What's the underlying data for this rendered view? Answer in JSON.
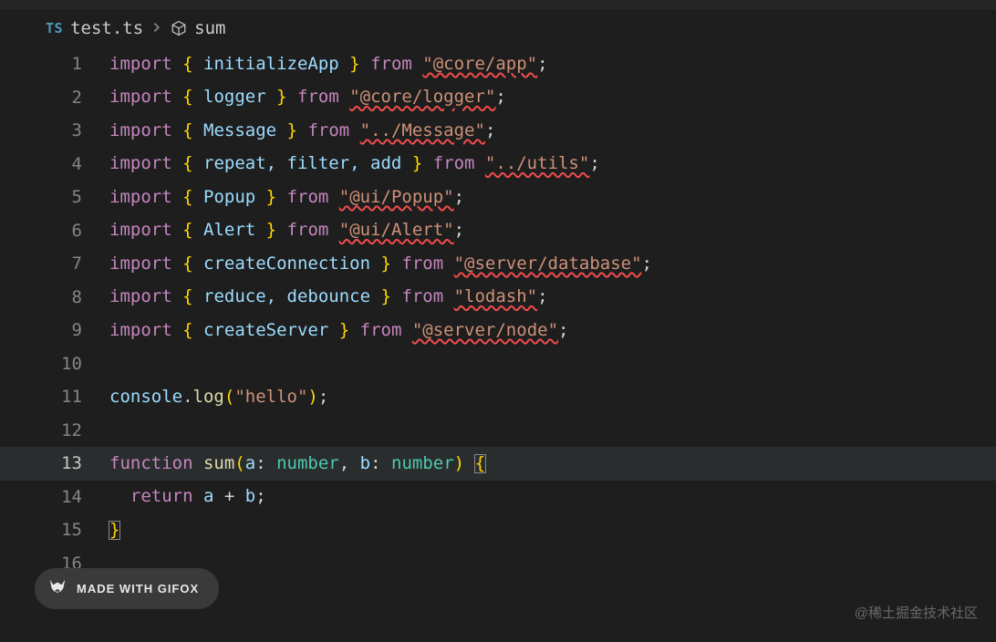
{
  "breadcrumb": {
    "ts_badge": "TS",
    "filename": "test.ts",
    "symbol": "sum"
  },
  "lines": {
    "l1": {
      "num": "1",
      "import": "import",
      "names": "initializeApp",
      "from": "from",
      "path": "\"@core/app\""
    },
    "l2": {
      "num": "2",
      "import": "import",
      "names": "logger",
      "from": "from",
      "path": "\"@core/logger\""
    },
    "l3": {
      "num": "3",
      "import": "import",
      "names": "Message",
      "from": "from",
      "path": "\"../Message\""
    },
    "l4": {
      "num": "4",
      "import": "import",
      "names": "repeat, filter, add",
      "from": "from",
      "path": "\"../utils\""
    },
    "l5": {
      "num": "5",
      "import": "import",
      "names": "Popup",
      "from": "from",
      "path": "\"@ui/Popup\""
    },
    "l6": {
      "num": "6",
      "import": "import",
      "names": "Alert",
      "from": "from",
      "path": "\"@ui/Alert\""
    },
    "l7": {
      "num": "7",
      "import": "import",
      "names": "createConnection",
      "from": "from",
      "path": "\"@server/database\""
    },
    "l8": {
      "num": "8",
      "import": "import",
      "names": "reduce, debounce",
      "from": "from",
      "path": "\"lodash\""
    },
    "l9": {
      "num": "9",
      "import": "import",
      "names": "createServer",
      "from": "from",
      "path": "\"@server/node\""
    },
    "l10": {
      "num": "10"
    },
    "l11": {
      "num": "11",
      "obj": "console",
      "method": "log",
      "arg": "\"hello\""
    },
    "l12": {
      "num": "12"
    },
    "l13": {
      "num": "13",
      "fn_kw": "function",
      "fn_name": "sum",
      "p1": "a",
      "p2": "b",
      "ptype": "number"
    },
    "l14": {
      "num": "14",
      "ret": "return",
      "expr_a": "a",
      "op": "+",
      "expr_b": "b"
    },
    "l15": {
      "num": "15"
    },
    "l16": {
      "num": "16"
    }
  },
  "watermark": {
    "badge": "MADE WITH GIFOX",
    "text": "@稀土掘金技术社区"
  }
}
